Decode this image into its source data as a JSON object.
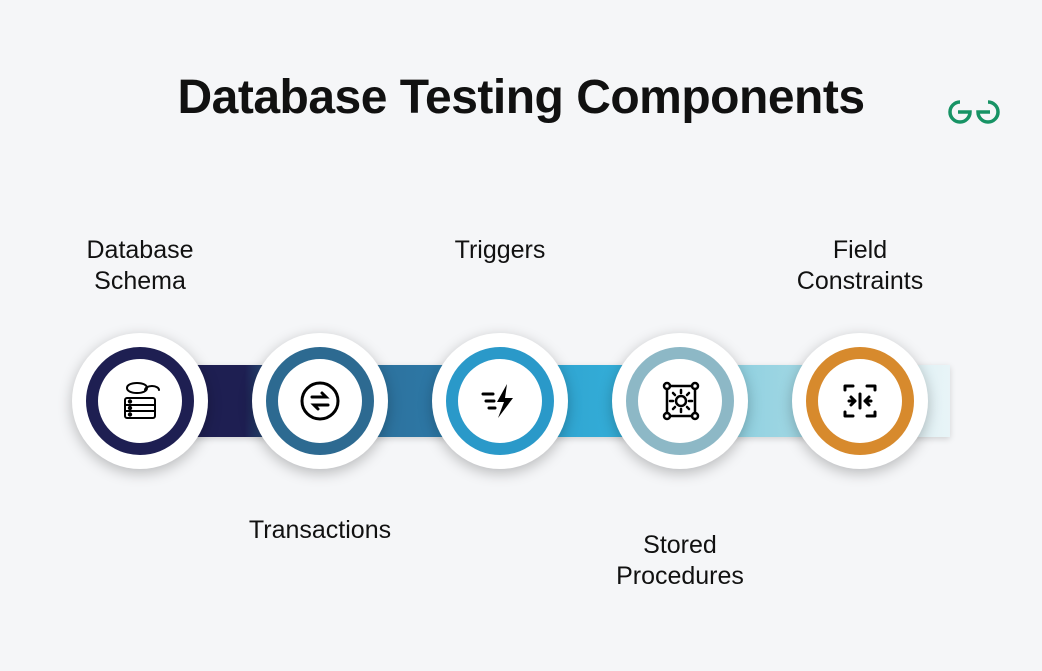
{
  "title": "Database Testing Components",
  "logo": {
    "name": "geeksforgeeks-logo",
    "color": "#179365"
  },
  "items": [
    {
      "label": "Database\nSchema",
      "labelPos": "top",
      "ringColor": "#1e1f52",
      "icon": "database-schema-icon"
    },
    {
      "label": "Transactions",
      "labelPos": "bottom",
      "ringColor": "#2d6a91",
      "icon": "transactions-icon"
    },
    {
      "label": "Triggers",
      "labelPos": "top",
      "ringColor": "#2a99c9",
      "icon": "trigger-icon"
    },
    {
      "label": "Stored\nProcedures",
      "labelPos": "bottom",
      "ringColor": "#8db8c6",
      "icon": "stored-procedures-icon"
    },
    {
      "label": "Field\nConstraints",
      "labelPos": "top",
      "ringColor": "#d78a2d",
      "icon": "field-constraints-icon"
    }
  ]
}
